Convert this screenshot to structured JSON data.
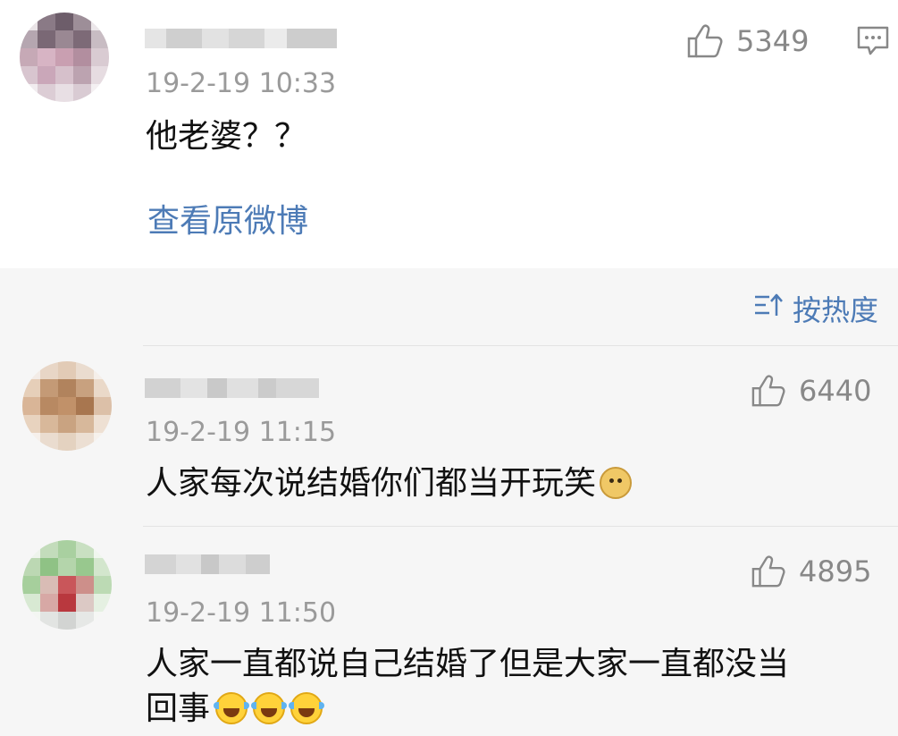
{
  "main_comment": {
    "timestamp": "19-2-19 10:33",
    "text": "他老婆？？",
    "like_count": "5349",
    "view_original_label": "查看原微博"
  },
  "sort": {
    "label": "按热度",
    "icon": "sort-icon"
  },
  "replies": [
    {
      "timestamp": "19-2-19 11:15",
      "text": "人家每次说结婚你们都当开玩笑",
      "like_count": "6440",
      "emojis": [
        "doge-emoji"
      ]
    },
    {
      "timestamp": "19-2-19 11:50",
      "text_line1": "人家一直都说自己结婚了但是大家一直都没当",
      "text_line2": "回事",
      "like_count": "4895",
      "emojis": [
        "laugh-cry-emoji",
        "laugh-cry-emoji",
        "laugh-cry-emoji"
      ]
    }
  ],
  "colors": {
    "link_blue": "#4d7bb6",
    "timestamp_gray": "#9a9a9a",
    "like_gray": "#888888",
    "reply_background": "#f6f6f6"
  }
}
